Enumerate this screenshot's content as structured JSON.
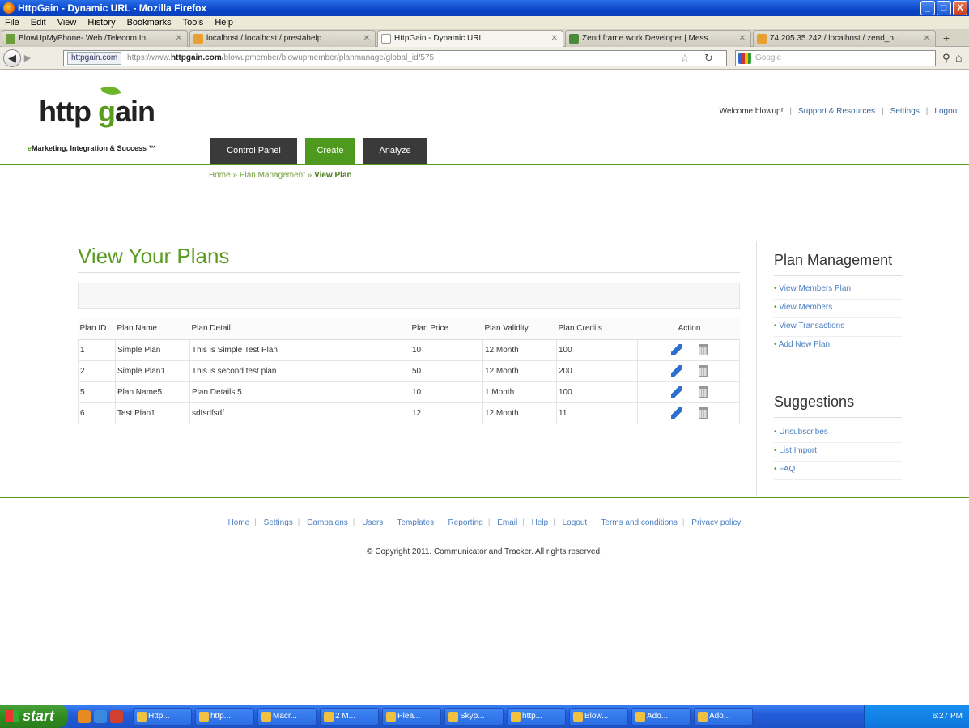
{
  "window": {
    "title": "HttpGain - Dynamic URL - Mozilla Firefox",
    "buttons": [
      "_",
      "□",
      "X"
    ]
  },
  "menu": [
    "File",
    "Edit",
    "View",
    "History",
    "Bookmarks",
    "Tools",
    "Help"
  ],
  "tabs": [
    {
      "label": "BlowUpMyPhone- Web /Telecom In...",
      "active": false
    },
    {
      "label": "localhost / localhost / prestahelp | ...",
      "active": false
    },
    {
      "label": "HttpGain - Dynamic URL",
      "active": true
    },
    {
      "label": "Zend frame work Developer | Mess...",
      "active": false
    },
    {
      "label": "74.205.35.242 / localhost / zend_h...",
      "active": false
    }
  ],
  "navbar": {
    "site_badge": "httpgain.com",
    "url_prefix": "https://www.",
    "url_domain": "httpgain.com",
    "url_path": "/blowupmember/blowupmember/planmanage/global_id/575",
    "search_placeholder": "Google"
  },
  "page": {
    "logo_text_a": "http ",
    "logo_text_b": "g",
    "logo_text_c": "ain",
    "tagline_e": "e",
    "tagline": "Marketing, Integration & Success ™",
    "top_links": {
      "welcome": "Welcome blowup!",
      "support": "Support & Resources",
      "settings": "Settings",
      "logout": "Logout"
    },
    "main_nav": {
      "control_panel": "Control Panel",
      "create": "Create",
      "analyze": "Analyze"
    },
    "breadcrumb": {
      "home": "Home",
      "plan_management": "Plan Management",
      "current": "View Plan",
      "sep": "»"
    },
    "title": "View Your Plans",
    "table": {
      "headers": [
        "Plan ID",
        "Plan Name",
        "Plan Detail",
        "Plan Price",
        "Plan Validity",
        "Plan Credits",
        "Action"
      ],
      "rows": [
        [
          "1",
          "Simple Plan",
          "This is Simple Test Plan",
          "10",
          "12 Month",
          "100"
        ],
        [
          "2",
          "Simple Plan1",
          "This is second test plan",
          "50",
          "12 Month",
          "200"
        ],
        [
          "5",
          "Plan Name5",
          "Plan Details 5",
          "10",
          "1 Month",
          "100"
        ],
        [
          "6",
          "Test Plan1",
          "sdfsdfsdf",
          "12",
          "12 Month",
          "11"
        ]
      ]
    },
    "sidebar": {
      "plan_management": {
        "heading": "Plan Management",
        "items": [
          "View Members Plan",
          "View Members",
          "View Transactions",
          "Add New Plan"
        ]
      },
      "suggestions": {
        "heading": "Suggestions",
        "items": [
          "Unsubscribes",
          "List Import",
          "FAQ"
        ]
      }
    },
    "footer": {
      "links": [
        "Home",
        "Settings",
        "Campaigns",
        "Users",
        "Templates",
        "Reporting",
        "Email",
        "Help",
        "Logout",
        "Terms and conditions",
        "Privacy policy"
      ],
      "copyright": "© Copyright 2011. Communicator and Tracker. All rights reserved."
    }
  },
  "taskbar": {
    "start": "start",
    "items": [
      "Http...",
      "http...",
      "Macr...",
      "2 M...",
      "Plea...",
      "Skyp...",
      "http...",
      "Blow...",
      "Ado...",
      "Ado..."
    ],
    "clock": "6:27 PM"
  }
}
